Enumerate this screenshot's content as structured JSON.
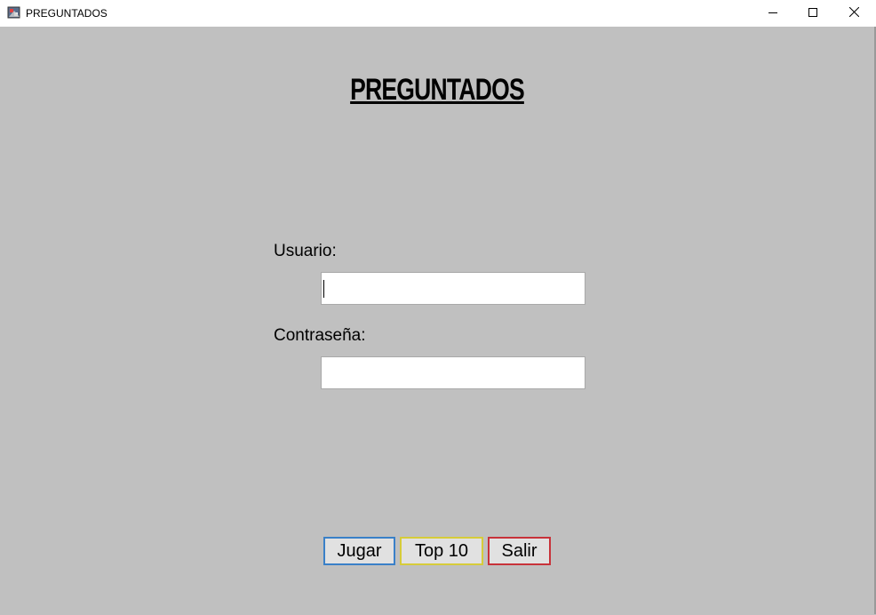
{
  "window": {
    "title": "PREGUNTADOS",
    "icon": "app-icon"
  },
  "controls": {
    "minimize_icon": "minimize-icon",
    "maximize_icon": "maximize-icon",
    "close_icon": "close-icon"
  },
  "main": {
    "heading": "PREGUNTADOS",
    "user_label": "Usuario:",
    "user_value": "",
    "pass_label": "Contraseña:",
    "pass_value": ""
  },
  "buttons": {
    "play_label": "Jugar",
    "top_label": "Top 10",
    "exit_label": "Salir"
  },
  "colors": {
    "background": "#c0c0c0",
    "play_border": "#3a80c8",
    "top_border": "#d6cc3a",
    "exit_border": "#c8323a"
  }
}
